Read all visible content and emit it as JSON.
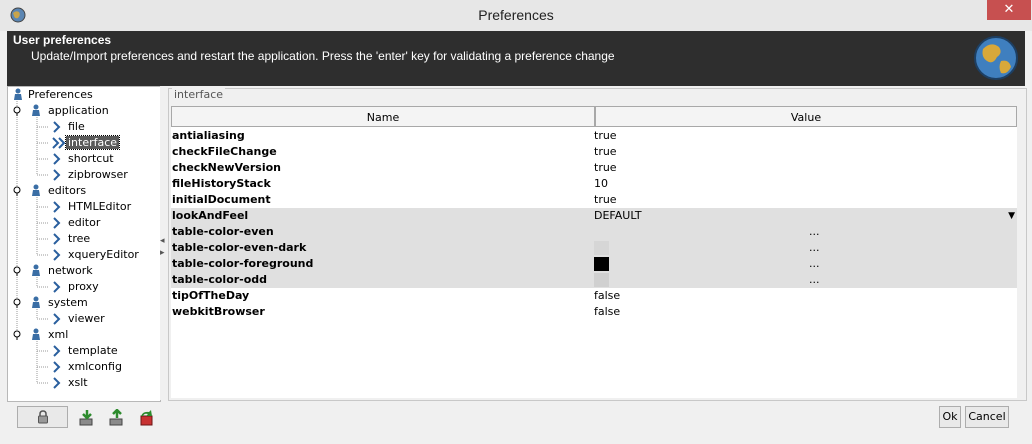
{
  "window": {
    "title": "Preferences",
    "close_glyph": "✕",
    "app_icon": "app-globe-icon"
  },
  "header": {
    "title": "User preferences",
    "description": "Update/Import preferences and restart the application. Press the 'enter' key for validating a preference change"
  },
  "tree": {
    "root": "Preferences",
    "groups": [
      {
        "label": "application",
        "children": [
          "file",
          "interface",
          "shortcut",
          "zipbrowser"
        ]
      },
      {
        "label": "editors",
        "children": [
          "HTMLEditor",
          "editor",
          "tree",
          "xqueryEditor"
        ]
      },
      {
        "label": "network",
        "children": [
          "proxy"
        ]
      },
      {
        "label": "system",
        "children": [
          "viewer"
        ]
      },
      {
        "label": "xml",
        "children": [
          "template",
          "xmlconfig",
          "xslt"
        ]
      }
    ],
    "selected": "interface"
  },
  "panel": {
    "group_title": "interface",
    "columns": [
      "Name",
      "Value"
    ],
    "rows": [
      {
        "name": "antialiasing",
        "value": "true"
      },
      {
        "name": "checkFileChange",
        "value": "true"
      },
      {
        "name": "checkNewVersion",
        "value": "true"
      },
      {
        "name": "fileHistoryStack",
        "value": "10"
      },
      {
        "name": "initialDocument",
        "value": "true"
      },
      {
        "name": "lookAndFeel",
        "value": "DEFAULT",
        "type": "dropdown"
      },
      {
        "name": "table-color-even",
        "value": "...",
        "type": "color",
        "color": "#e0e0e0"
      },
      {
        "name": "table-color-even-dark",
        "value": "...",
        "type": "color",
        "color": "#d6d6d6"
      },
      {
        "name": "table-color-foreground",
        "value": "...",
        "type": "color",
        "color": "#000000"
      },
      {
        "name": "table-color-odd",
        "value": "...",
        "type": "color",
        "color": "#d0d0d0"
      },
      {
        "name": "tipOfTheDay",
        "value": "false"
      },
      {
        "name": "webkitBrowser",
        "value": "false"
      }
    ]
  },
  "footer": {
    "ok_label": "Ok",
    "cancel_label": "Cancel",
    "icons": [
      "lock-icon",
      "import-icon",
      "export-icon",
      "reset-icon"
    ]
  },
  "colors": {
    "header_bg": "#2e2e2e",
    "close_bg": "#c75050",
    "selection_bg": "#5a5a5a"
  }
}
